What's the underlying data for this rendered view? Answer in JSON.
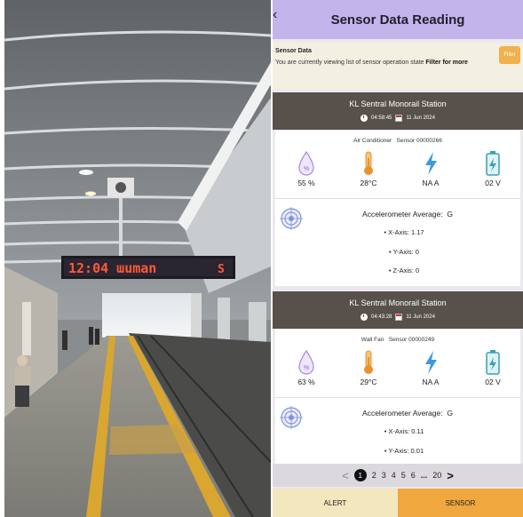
{
  "photo": {
    "led_sign_text": "12:04 ɯuman",
    "led_sign_suffix": "S"
  },
  "app": {
    "title": "Sensor Data Reading",
    "back_icon": "chevron-left-icon"
  },
  "info": {
    "heading": "Sensor Data",
    "description": "You are currently viewing list of sensor operation state",
    "filter_prompt": "Filter for more",
    "filter_button": "Filter"
  },
  "records": [
    {
      "station": "KL Sentral Monorail Station",
      "time": "04:58:45",
      "date": "11 Jun 2024",
      "device": "Air Conditioner",
      "sensor": "Sensor 00000266",
      "humidity": "55 %",
      "temperature": "28°C",
      "current": "NA A",
      "voltage": "02 V",
      "accel_heading": "Accelerometer Average:",
      "accel_unit": "G",
      "x_axis": "• X-Axis: 1.17",
      "y_axis": "• Y-Axis: 0",
      "z_axis": "• Z-Axis: 0"
    },
    {
      "station": "KL Sentral Monorail Station",
      "time": "04:43:28",
      "date": "11 Jun 2024",
      "device": "Wall Fan",
      "sensor": "Sensor 00000249",
      "humidity": "63 %",
      "temperature": "29°C",
      "current": "NA A",
      "voltage": "02 V",
      "accel_heading": "Accelerometer Average:",
      "accel_unit": "G",
      "x_axis": "• X-Axis: 0.11",
      "y_axis": "• Y-Axis: 0.01"
    }
  ],
  "pagination": {
    "prev": "<",
    "current": "1",
    "pages": [
      "2",
      "3",
      "4",
      "5",
      "6"
    ],
    "ellipsis": "...",
    "last": "20",
    "next": ">"
  },
  "nav": {
    "alert": "ALERT",
    "sensor": "SENSOR"
  },
  "colors": {
    "header": "#c3b4ec",
    "station_bar": "#57504b",
    "accent": "#f0a73d",
    "alert_tab": "#f3e7bd",
    "humidity_icon": "#a98ad8",
    "temperature_icon": "#e8932e",
    "current_icon": "#3a9be0",
    "voltage_icon": "#3aa0b4"
  }
}
